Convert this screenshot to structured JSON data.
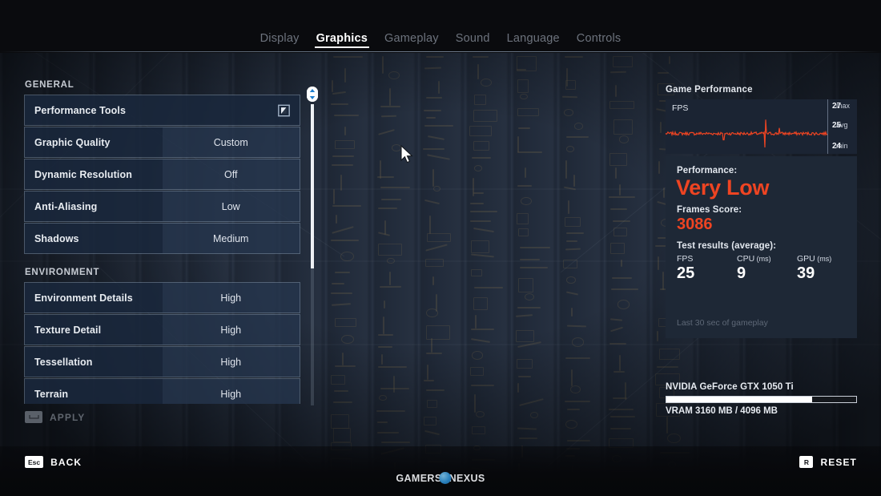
{
  "nav": {
    "tabs": [
      {
        "label": "Display",
        "active": false
      },
      {
        "label": "Graphics",
        "active": true
      },
      {
        "label": "Gameplay",
        "active": false
      },
      {
        "label": "Sound",
        "active": false
      },
      {
        "label": "Language",
        "active": false
      },
      {
        "label": "Controls",
        "active": false
      }
    ]
  },
  "settings": {
    "groups": [
      {
        "title": "GENERAL",
        "rows": [
          {
            "label": "Performance Tools",
            "value": "",
            "icon": "external-window-icon"
          },
          {
            "label": "Graphic Quality",
            "value": "Custom"
          },
          {
            "label": "Dynamic Resolution",
            "value": "Off"
          },
          {
            "label": "Anti-Aliasing",
            "value": "Low"
          },
          {
            "label": "Shadows",
            "value": "Medium"
          }
        ]
      },
      {
        "title": "ENVIRONMENT",
        "rows": [
          {
            "label": "Environment Details",
            "value": "High"
          },
          {
            "label": "Texture Detail",
            "value": "High"
          },
          {
            "label": "Tessellation",
            "value": "High"
          },
          {
            "label": "Terrain",
            "value": "High"
          }
        ]
      }
    ]
  },
  "performance": {
    "title": "Game Performance",
    "fps_graph": {
      "label": "FPS",
      "max_value": "27",
      "max_unit": "max",
      "avg_value": "25",
      "avg_unit": "avg",
      "min_value": "24",
      "min_unit": "min",
      "line_color": "#ee4422"
    },
    "performance_label": "Performance:",
    "performance_rating": "Very Low",
    "frames_score_label": "Frames Score:",
    "frames_score": "3086",
    "test_results_label": "Test results (average):",
    "metrics": [
      {
        "caption": "FPS",
        "unit": "",
        "value": "25"
      },
      {
        "caption": "CPU",
        "unit": "(ms)",
        "value": "9"
      },
      {
        "caption": "GPU",
        "unit": "(ms)",
        "value": "39"
      }
    ],
    "footer": "Last 30 sec of gameplay",
    "accent_color": "#ee4422"
  },
  "gpu": {
    "name": "NVIDIA GeForce GTX 1050 Ti",
    "vram_text": "VRAM 3160 MB / 4096 MB",
    "vram_used_mb": 3160,
    "vram_total_mb": 4096,
    "vram_percent": 77
  },
  "buttons": {
    "apply": {
      "key": "⌴",
      "label": "APPLY",
      "enabled": false
    },
    "back": {
      "key": "Esc",
      "label": "BACK",
      "enabled": true
    },
    "reset": {
      "key": "R",
      "label": "RESET",
      "enabled": true
    }
  },
  "watermark": {
    "part1": "GAMERS",
    "part2": "NEXUS"
  }
}
